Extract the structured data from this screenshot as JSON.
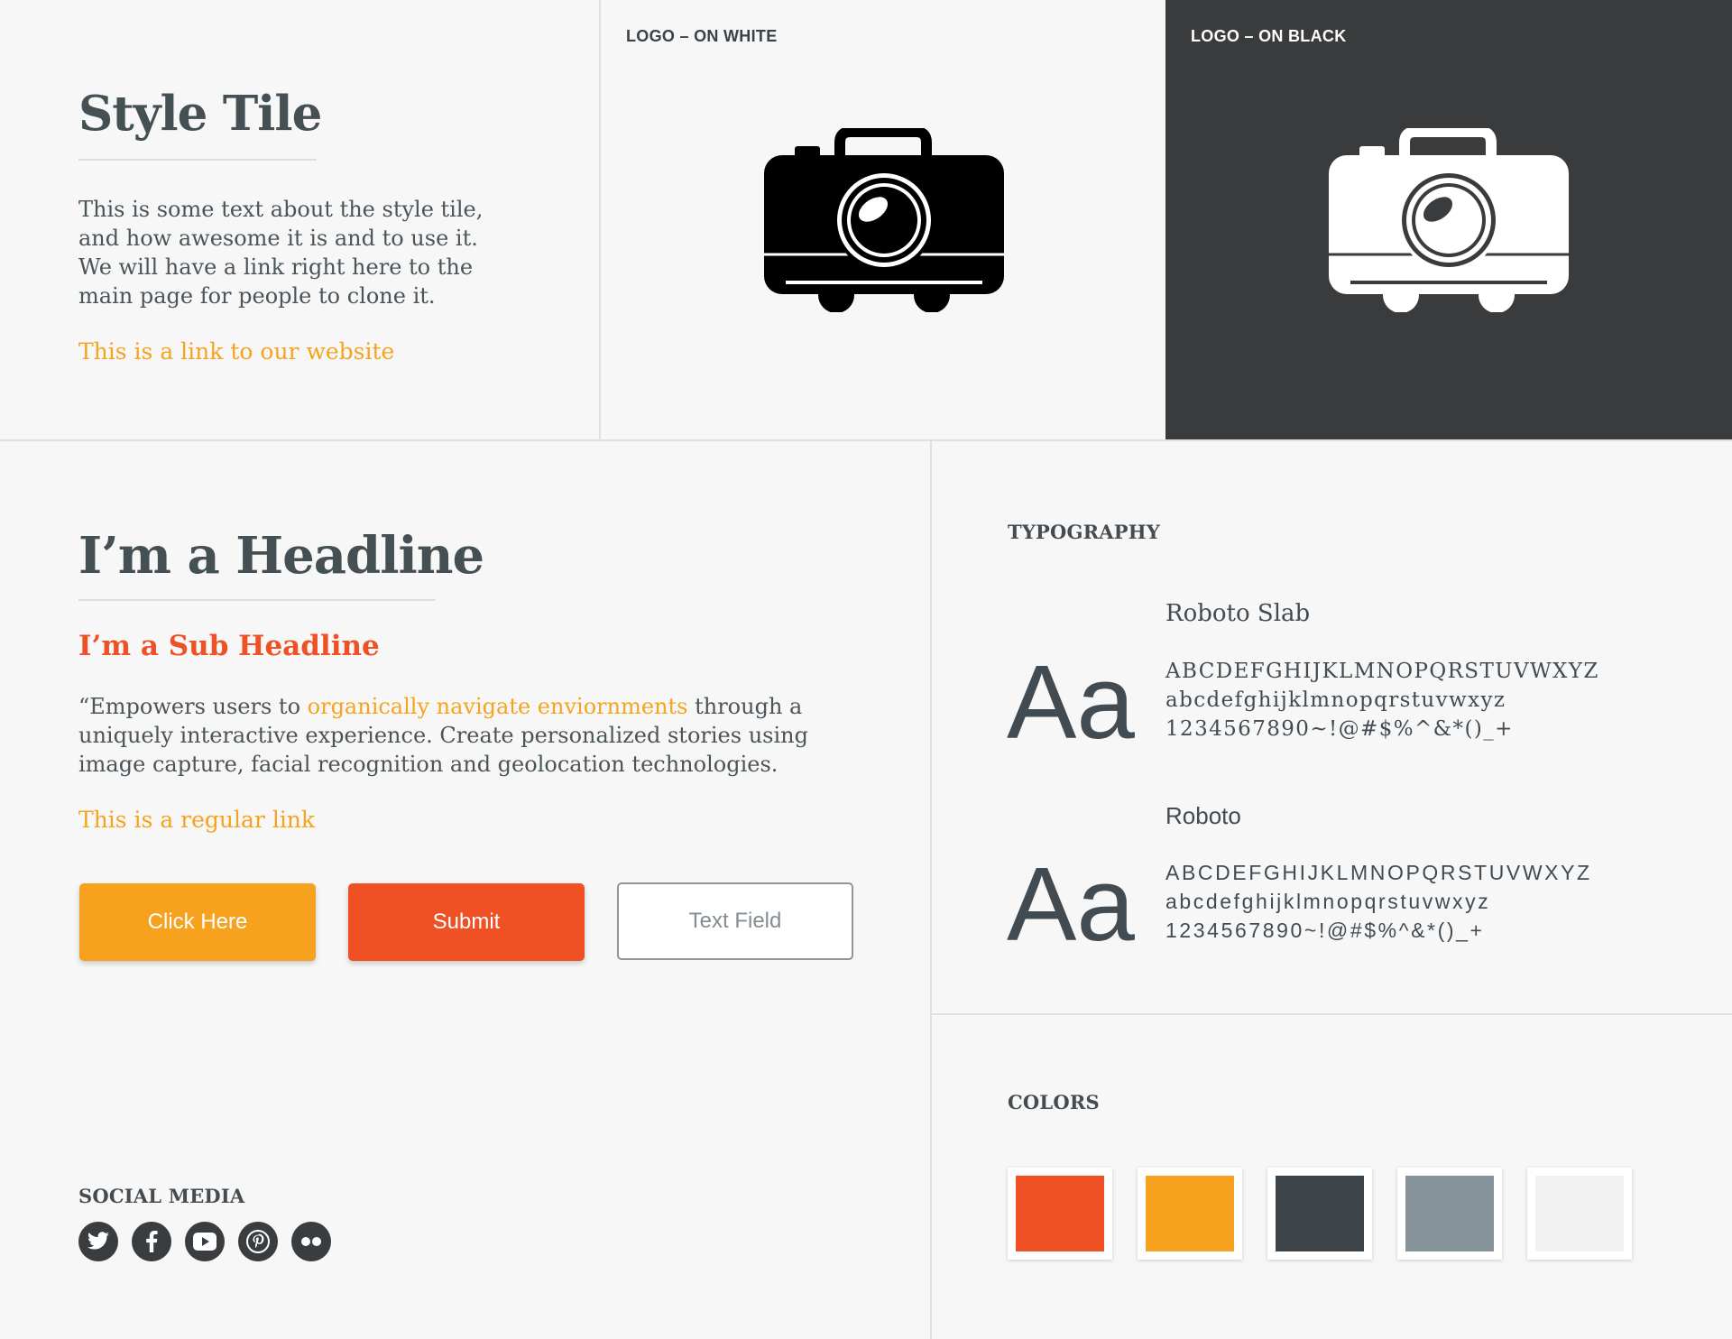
{
  "intro": {
    "title": "Style Tile",
    "body_lines": [
      "This is some text about the style tile,",
      "and how awesome it is and to use it.",
      "We will have a link right here to the",
      "main page for people to clone it."
    ],
    "website_link": "This is a link to our website"
  },
  "logos": {
    "on_white_label": "LOGO – ON WHITE",
    "on_black_label": "LOGO – ON BLACK",
    "icon": "camera-icon"
  },
  "content": {
    "headline": "I’m a Headline",
    "subheadline": "I’m a Sub Headline",
    "quote_start": "“Empowers users to ",
    "quote_link": "organically navigate enviornments",
    "quote_after_link": " through a",
    "quote_line2": "uniquely interactive experience. Create personalized stories using",
    "quote_line3": "image capture, facial recognition and geolocation technologies.",
    "regular_link": "This is a regular link",
    "buttons": {
      "primary_label": "Click Here",
      "submit_label": "Submit",
      "text_field_placeholder": "Text Field"
    }
  },
  "social": {
    "label": "SOCIAL MEDIA",
    "icons": [
      "twitter-icon",
      "facebook-icon",
      "youtube-icon",
      "pinterest-icon",
      "flickr-icon"
    ]
  },
  "typography": {
    "label": "TYPOGRAPHY",
    "fonts": [
      {
        "name": "Roboto Slab",
        "sample": "Aa",
        "uppercase": "ABCDEFGHIJKLMNOPQRSTUVWXYZ",
        "lowercase": "abcdefghijklmnopqrstuvwxyz",
        "numbers": "1234567890~!@#$%^&*()_+"
      },
      {
        "name": "Roboto",
        "sample": "Aa",
        "uppercase": "ABCDEFGHIJKLMNOPQRSTUVWXYZ",
        "lowercase": "abcdefghijklmnopqrstuvwxyz",
        "numbers": "1234567890~!@#$%^&*()_+"
      }
    ]
  },
  "colors": {
    "label": "COLORS",
    "palette": [
      "#ef5024",
      "#f6a21f",
      "#3c4449",
      "#87939a",
      "#f1f1f1"
    ]
  }
}
